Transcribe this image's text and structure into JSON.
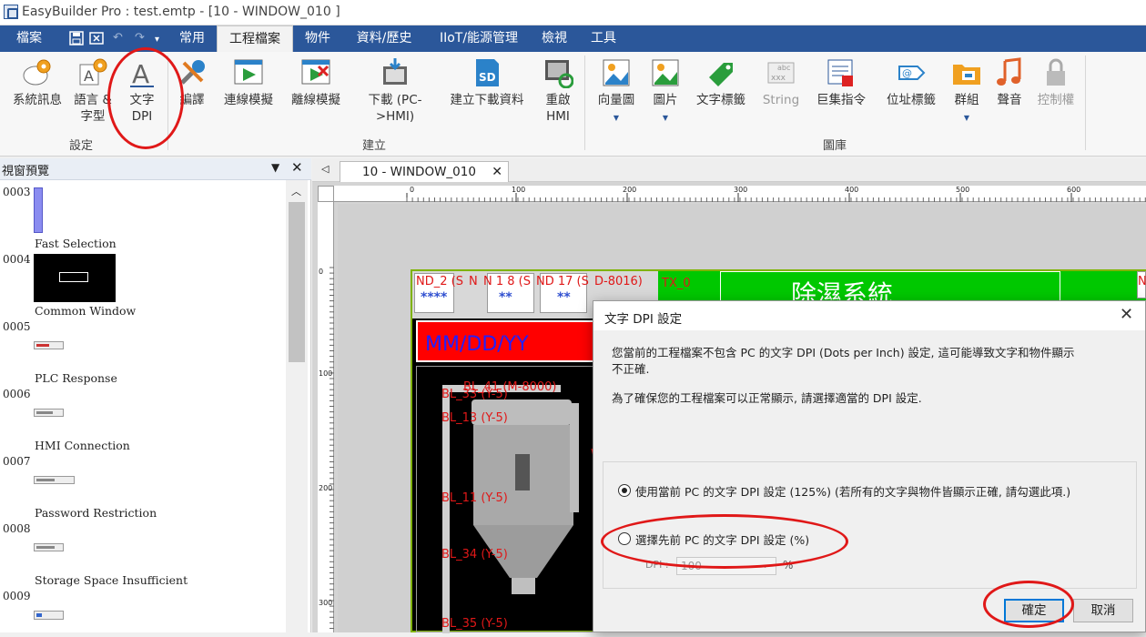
{
  "window": {
    "title": "EasyBuilder Pro : test.emtp - [10 - WINDOW_010 ]"
  },
  "menu": {
    "tabs": [
      "檔案",
      "常用",
      "工程檔案",
      "物件",
      "資料/歷史",
      "IIoT/能源管理",
      "檢視",
      "工具"
    ],
    "active": "工程檔案"
  },
  "ribbon": {
    "groups": {
      "settings": "設定",
      "build": "建立",
      "library": "圖庫"
    },
    "buttons": {
      "system_info": "系統訊息",
      "language_font_1": "語言 &",
      "language_font_2": "字型",
      "text_dpi_1": "文字",
      "text_dpi_2": "DPI",
      "compile": "編譯",
      "online_sim": "連線模擬",
      "offline_sim": "離線模擬",
      "download_1": "下載 (PC-",
      "download_2": ">HMI)",
      "build_download": "建立下載資料",
      "restart_1": "重啟",
      "restart_2": "HMI",
      "vector_image": "向量圖",
      "picture": "圖片",
      "text_tag": "文字標籤",
      "string": "String",
      "macro": "巨集指令",
      "address_tag": "位址標籤",
      "group": "群組",
      "sound": "聲音",
      "access_control": "控制權"
    }
  },
  "left_panel": {
    "title": "視窗預覽",
    "items": [
      {
        "num": "0003",
        "name": "Fast Selection"
      },
      {
        "num": "0004",
        "name": "Common Window"
      },
      {
        "num": "0005",
        "name": "PLC Response"
      },
      {
        "num": "0006",
        "name": "HMI Connection"
      },
      {
        "num": "0007",
        "name": "Password Restriction"
      },
      {
        "num": "0008",
        "name": "Storage Space Insufficient"
      },
      {
        "num": "0009",
        "name": ""
      }
    ]
  },
  "editor": {
    "tab": "10 - WINDOW_010",
    "ruler_h": [
      "0",
      "100",
      "200",
      "300",
      "400",
      "500",
      "600"
    ],
    "ruler_v": [
      "0",
      "100",
      "200",
      "300"
    ],
    "hmi_labels": {
      "nd1": "ND_2 (S",
      "nd2": "N",
      "nd3": "N 1 8 (S",
      "nd4": "ND 17 (S",
      "nd5": "D-8016)",
      "nd6": "N",
      "stars1": "****",
      "stars2": "**",
      "stars3": "**",
      "tx": "TX_0",
      "title_cn": "除濕系統",
      "date": "MM/DD/YY",
      "bl41": "BL_41 (M-8000)",
      "bl33": "BL_33 (Y-5)",
      "bl13": "BL_13 (Y-5)",
      "bl11": "BL_11 (Y-5)",
      "bl34": "BL_34 (Y-5)",
      "bl35": "BL_35 (Y-5)",
      "w": "W"
    }
  },
  "dialog": {
    "title": "文字 DPI 設定",
    "message_1": "您當前的工程檔案不包含 PC 的文字 DPI (Dots per Inch) 設定, 這可能導致文字和物件顯示",
    "message_1b": "不正確.",
    "message_2": "為了確保您的工程檔案可以正常顯示, 請選擇適當的 DPI 設定.",
    "option_current": "使用當前 PC 的文字 DPI 設定 (125%) (若所有的文字與物件皆顯示正確, 請勾選此項.)",
    "option_previous": "選擇先前 PC 的文字 DPI 設定 (%)",
    "dpi_label": "DPI :",
    "dpi_value": "100",
    "percent": "%",
    "ok": "確定",
    "cancel": "取消"
  },
  "colors": {
    "accent": "#2b579a",
    "highlight": "#e01818",
    "hmi_green": "#00c800",
    "hmi_red": "#ff0000",
    "hmi_border": "#7fb300"
  }
}
